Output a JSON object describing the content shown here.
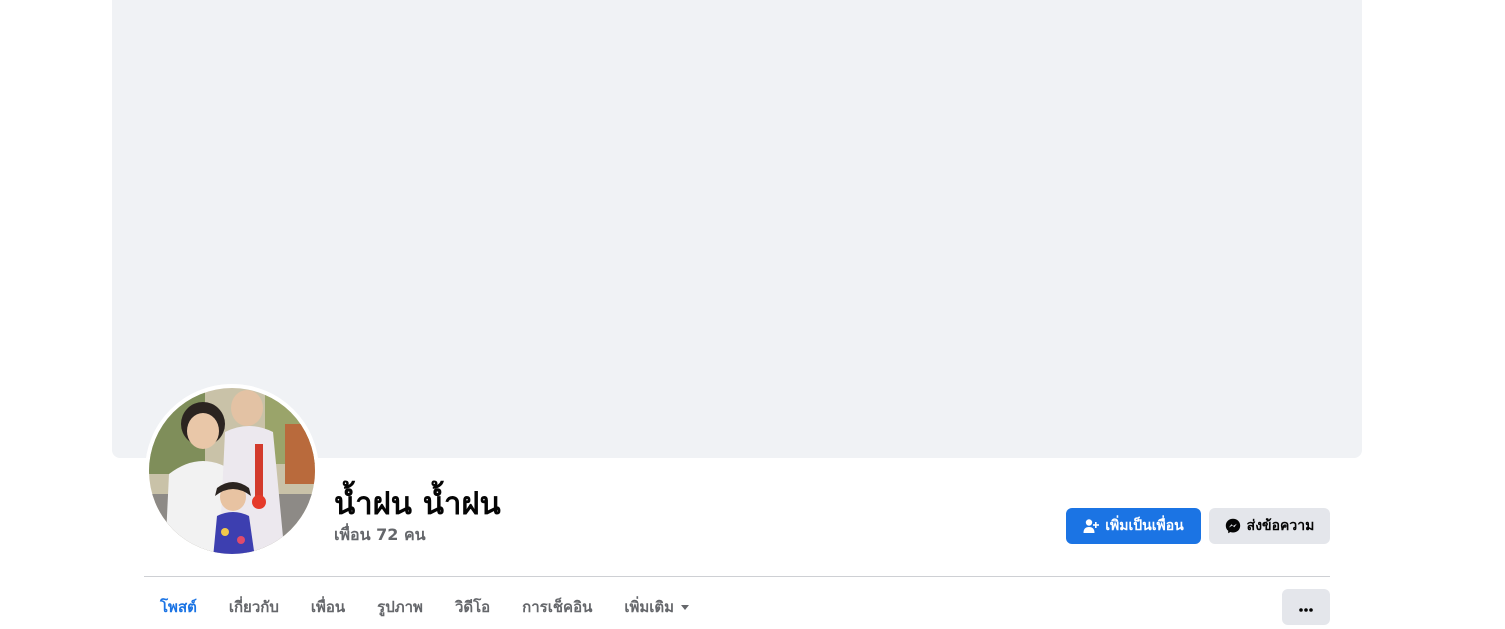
{
  "profile": {
    "name": "น้ำฝน น้ำฝน",
    "friends_count_text": "เพื่อน 72 คน"
  },
  "actions": {
    "add_friend_label": "เพิ่มเป็นเพื่อน",
    "message_label": "ส่งข้อความ"
  },
  "tabs": [
    {
      "label": "โพสต์",
      "active": true
    },
    {
      "label": "เกี่ยวกับ"
    },
    {
      "label": "เพื่อน"
    },
    {
      "label": "รูปภาพ"
    },
    {
      "label": "วิดีโอ"
    },
    {
      "label": "การเช็คอิน"
    },
    {
      "label": "เพิ่มเติม",
      "has_dropdown": true
    }
  ],
  "icons": {
    "add_friend": "person-add-icon",
    "message": "messenger-icon",
    "dropdown": "caret-down-icon",
    "more": "ellipsis-icon"
  },
  "colors": {
    "accent": "#1b74e4",
    "cover": "#f0f2f5",
    "secondary_button": "#e4e6eb",
    "muted_text": "#65676b"
  }
}
